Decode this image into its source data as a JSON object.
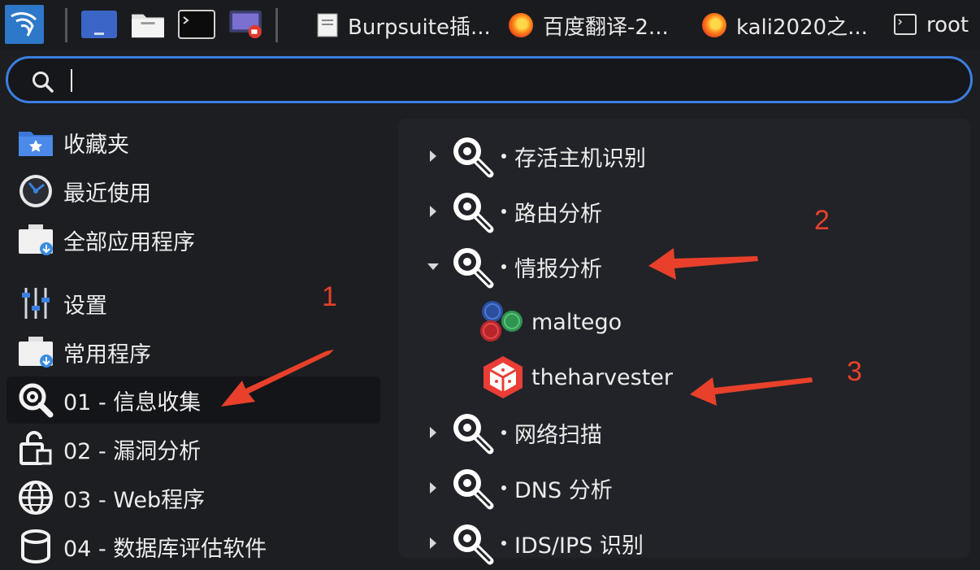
{
  "taskbar": {
    "tasks": [
      {
        "label": "Burpsuite插...",
        "icon": "document-icon"
      },
      {
        "label": "百度翻译-2...",
        "icon": "firefox-icon"
      },
      {
        "label": "kali2020之...",
        "icon": "firefox-icon"
      },
      {
        "label": "root",
        "icon": "terminal-icon"
      }
    ]
  },
  "search": {
    "placeholder": "",
    "value": ""
  },
  "left_menu": {
    "items": [
      {
        "label": "收藏夹",
        "icon": "favorites-folder-icon"
      },
      {
        "label": "最近使用",
        "icon": "recent-clock-icon"
      },
      {
        "label": "全部应用程序",
        "icon": "all-apps-icon"
      },
      {
        "label": "设置",
        "icon": "settings-sliders-icon"
      },
      {
        "label": "常用程序",
        "icon": "common-apps-icon"
      },
      {
        "label": "01 - 信息收集",
        "icon": "magnifier-icon"
      },
      {
        "label": "02 - 漏洞分析",
        "icon": "vulnerability-icon"
      },
      {
        "label": "03 - Web程序",
        "icon": "globe-icon"
      },
      {
        "label": "04 - 数据库评估软件",
        "icon": "database-icon"
      }
    ]
  },
  "right_menu": {
    "categories": [
      {
        "label": "存活主机识别",
        "expanded": false
      },
      {
        "label": "路由分析",
        "expanded": false
      },
      {
        "label": "情报分析",
        "expanded": true
      },
      {
        "label": "网络扫描",
        "expanded": false
      },
      {
        "label": "DNS 分析",
        "expanded": false
      },
      {
        "label": "IDS/IPS 识别",
        "expanded": false
      }
    ],
    "apps": [
      {
        "label": "maltego",
        "icon": "maltego-icon"
      },
      {
        "label": "theharvester",
        "icon": "theharvester-icon"
      }
    ]
  },
  "annotations": {
    "a1": "1",
    "a2": "2",
    "a3": "3"
  },
  "colors": {
    "accent": "#3a7fe0",
    "annotation": "#e8402a",
    "panel": "#212328"
  }
}
